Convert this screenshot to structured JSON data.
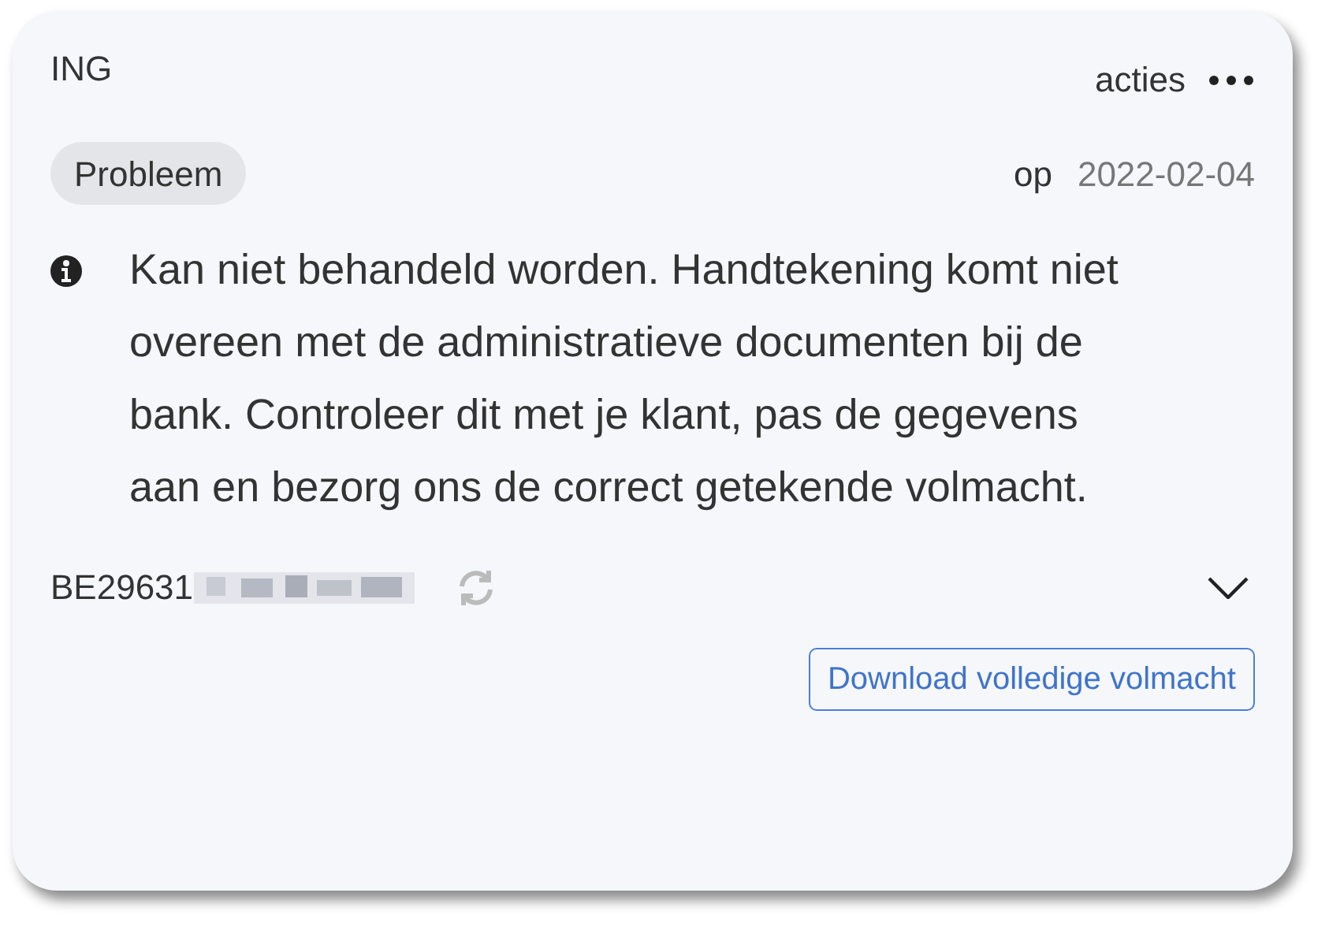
{
  "bank": "ING",
  "actions": {
    "label": "acties"
  },
  "status": {
    "label": "Probleem",
    "prefix": "op",
    "date": "2022-02-04"
  },
  "message": "Kan niet behandeld worden. Handtekening komt niet overeen met de administratieve documenten bij de bank. Controleer dit met je klant, pas de gegevens aan en bezorg ons de correct getekende volmacht.",
  "account": {
    "number": "BE29631",
    "expanded": false
  },
  "download_button": "Download volledige volmacht"
}
